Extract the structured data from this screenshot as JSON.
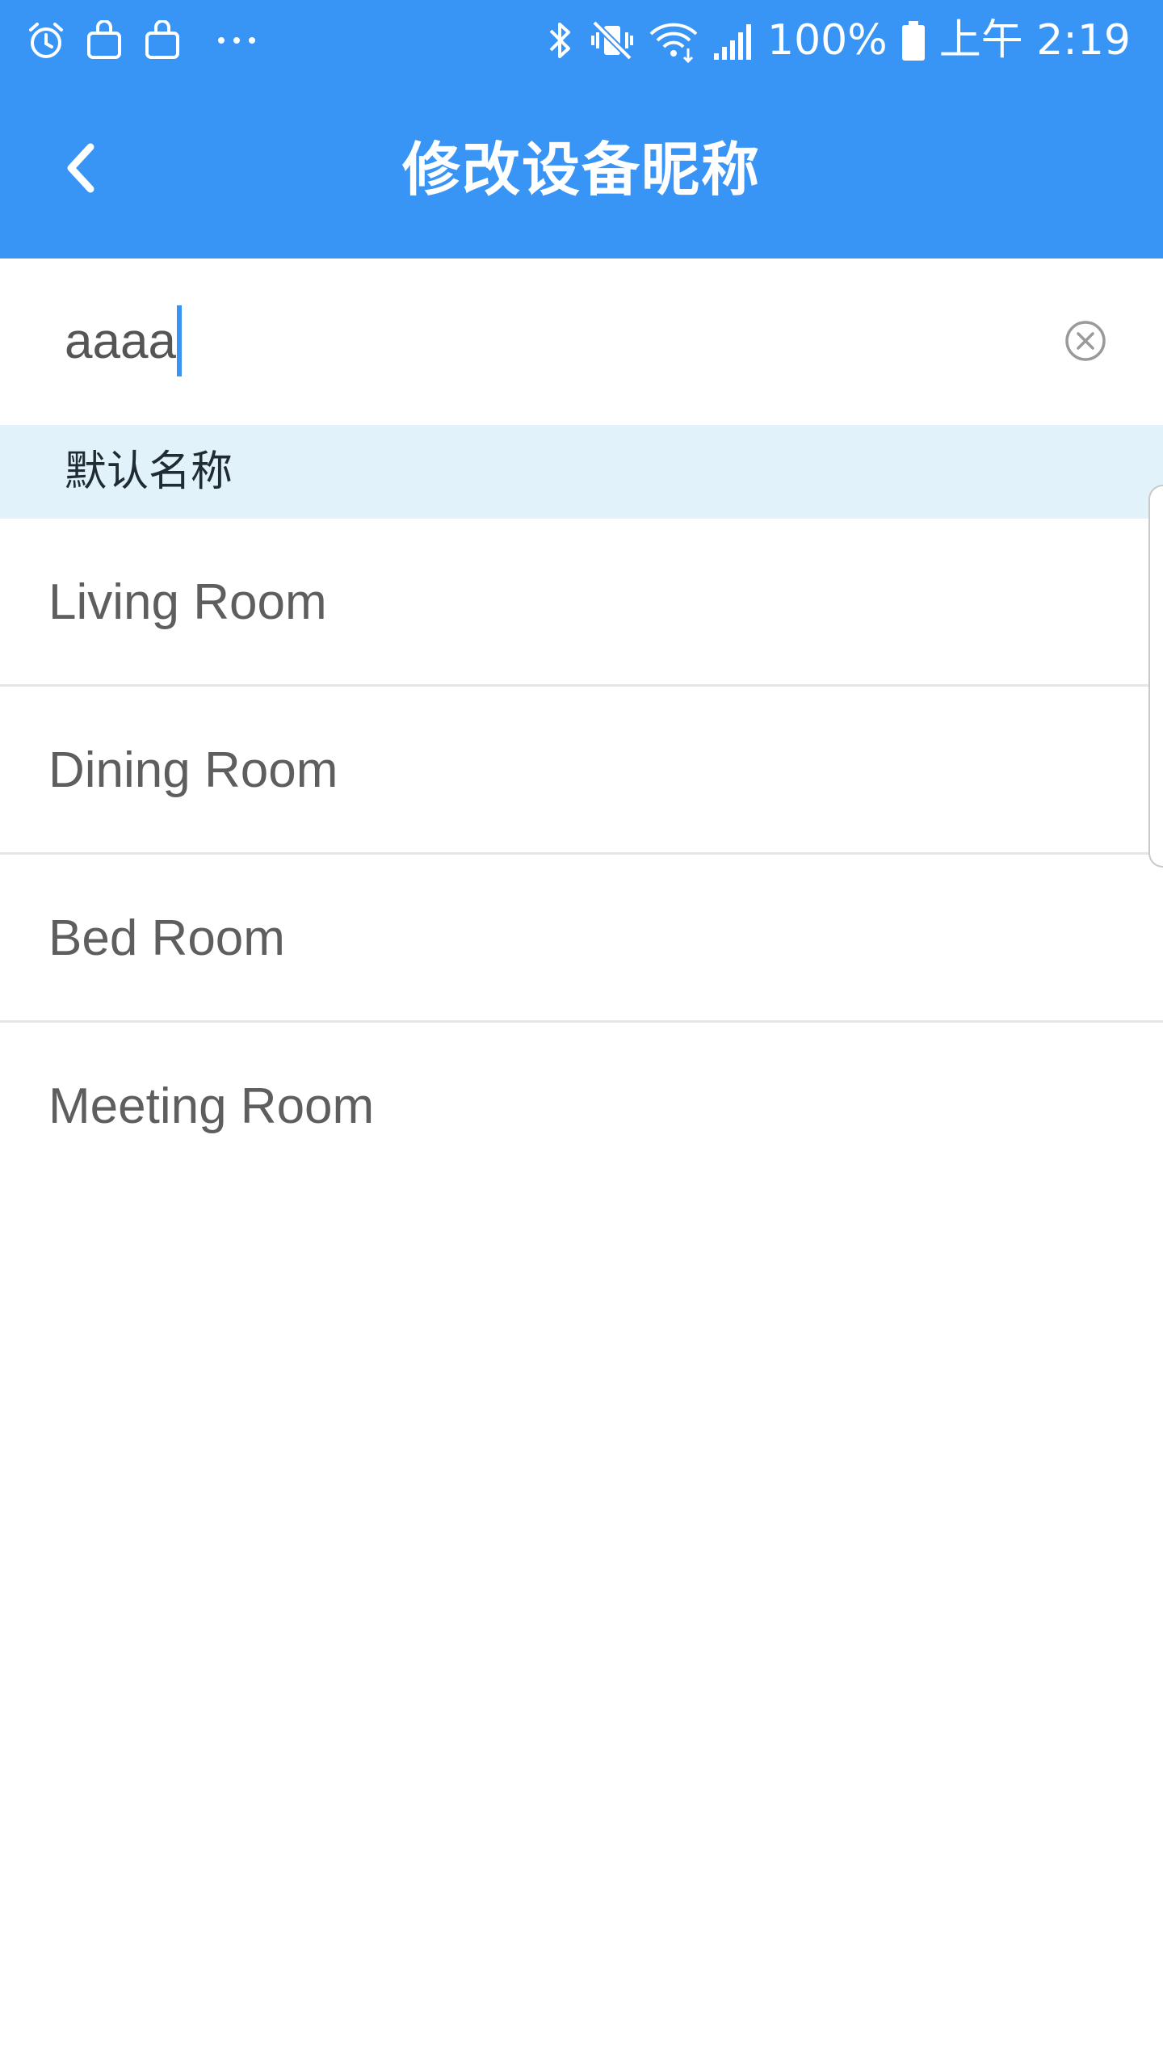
{
  "status_bar": {
    "battery_percent": "100%",
    "time": "上午 2:19",
    "left_icons": [
      "alarm-icon",
      "shopping-bag-icon",
      "shopping-bag-icon",
      "more-dots-icon"
    ],
    "right_icons": [
      "bluetooth-icon",
      "vibrate-mute-icon",
      "wifi-icon",
      "signal-icon",
      "battery-icon"
    ]
  },
  "header": {
    "title": "修改设备昵称",
    "back_icon": "chevron-left-icon",
    "background_color": "#3894f5"
  },
  "input": {
    "value": "aaaa",
    "clear_icon": "clear-circle-icon"
  },
  "section": {
    "title": "默认名称",
    "background_color": "#e1f2fb"
  },
  "default_names": [
    {
      "label": "Living Room"
    },
    {
      "label": "Dining Room"
    },
    {
      "label": "Bed Room"
    },
    {
      "label": "Meeting Room"
    }
  ]
}
